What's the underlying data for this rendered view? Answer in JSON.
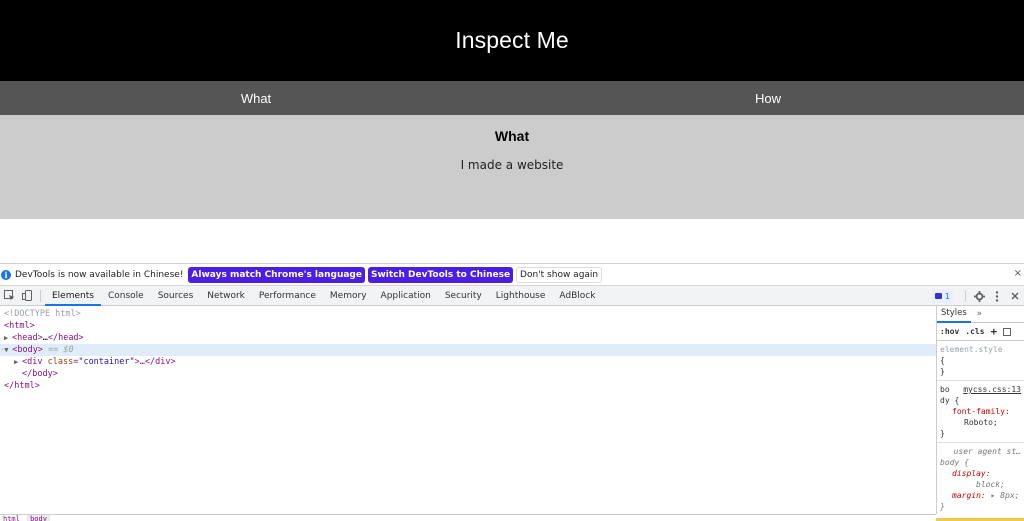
{
  "site": {
    "title": "Inspect Me",
    "nav": [
      "What",
      "How"
    ],
    "content_heading": "What",
    "content_text": "I made a website"
  },
  "devtools": {
    "infobar": {
      "message": "DevTools is now available in Chinese!",
      "btn_match": "Always match Chrome's language",
      "btn_switch": "Switch DevTools to Chinese",
      "btn_dismiss": "Don't show again",
      "close": "×"
    },
    "tabs": [
      "Elements",
      "Console",
      "Sources",
      "Network",
      "Performance",
      "Memory",
      "Application",
      "Security",
      "Lighthouse",
      "AdBlock"
    ],
    "issues_count": "1",
    "dom": {
      "doctype": "<!DOCTYPE html>",
      "html_open": "<html>",
      "head": "<head>",
      "head_ellipsis": "…",
      "head_close": "</head>",
      "body_open": "<body>",
      "body_marker": "== $0",
      "div_open": "<div",
      "div_attr_name": "class",
      "div_attr_value": "\"container\"",
      "div_ellipsis": ">…</div>",
      "body_close": "</body>",
      "html_close": "</html>"
    },
    "styles": {
      "tab_styles": "Styles",
      "more": "»",
      "hov": ":hov",
      "cls": ".cls",
      "plus": "+",
      "element_style": "element.style",
      "brace_open": "{",
      "brace_close": "}",
      "rule1_selector_a": "bo",
      "rule1_selector_b": "dy {",
      "rule1_source": "mycss.css:13",
      "rule1_prop": "font-family:",
      "rule1_value": "Roboto;",
      "ua_label": "user agent st…",
      "ua_selector": "body {",
      "ua_prop1": "display:",
      "ua_val1": "block;",
      "ua_prop2": "margin:",
      "ua_val2": "▸ 8px;"
    },
    "breadcrumbs": [
      "html",
      "body"
    ]
  }
}
